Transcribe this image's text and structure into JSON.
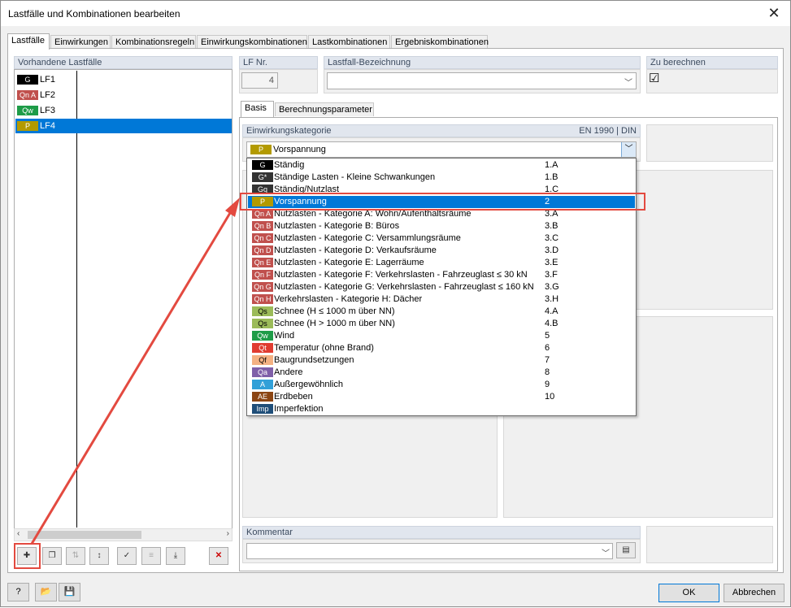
{
  "window": {
    "title": "Lastfälle und Kombinationen bearbeiten",
    "close": "✕"
  },
  "tabs": [
    {
      "label": "Lastfälle"
    },
    {
      "label": "Einwirkungen"
    },
    {
      "label": "Kombinationsregeln"
    },
    {
      "label": "Einwirkungskombinationen"
    },
    {
      "label": "Lastkombinationen"
    },
    {
      "label": "Ergebniskombinationen"
    }
  ],
  "list": {
    "header": "Vorhandene Lastfälle",
    "items": [
      {
        "badge": "G",
        "name": "LF1",
        "color": "#000000"
      },
      {
        "badge": "Qn A",
        "name": "LF2",
        "color": "#c0504d"
      },
      {
        "badge": "Qw",
        "name": "LF3",
        "color": "#1e9c48"
      },
      {
        "badge": "P",
        "name": "LF4",
        "color": "#b39a00"
      }
    ]
  },
  "toolbar_icons": [
    "new-loadcase-icon",
    "copy-loadcase-icon",
    "renumber-icon",
    "sort-icon",
    "check-icon",
    "generate-icon",
    "import-icon",
    "delete-icon"
  ],
  "lf_nr": {
    "header": "LF Nr.",
    "value": "4"
  },
  "bezeichnung": {
    "header": "Lastfall-Bezeichnung",
    "value": ""
  },
  "zu_berechnen": {
    "header": "Zu berechnen",
    "check": "☑"
  },
  "subtabs": [
    {
      "label": "Basis"
    },
    {
      "label": "Berechnungsparameter"
    }
  ],
  "kategorie": {
    "header": "Einwirkungskategorie",
    "norm": "EN 1990 | DIN",
    "selected_badge": "P",
    "selected_label": "Vorspannung",
    "selected_color": "#b39a00",
    "options": [
      {
        "badge": "G",
        "label": "Ständig",
        "code": "1.A",
        "color": "#000000"
      },
      {
        "badge": "G*",
        "label": "Ständige Lasten - Kleine Schwankungen",
        "code": "1.B",
        "color": "#333333"
      },
      {
        "badge": "Gq",
        "label": "Ständig/Nutzlast",
        "code": "1.C",
        "color": "#333333"
      },
      {
        "badge": "P",
        "label": "Vorspannung",
        "code": "2",
        "color": "#b39a00"
      },
      {
        "badge": "Qn A",
        "label": "Nutzlasten - Kategorie A: Wohn/Aufenthaltsräume",
        "code": "3.A",
        "color": "#c0504d"
      },
      {
        "badge": "Qn B",
        "label": "Nutzlasten - Kategorie B: Büros",
        "code": "3.B",
        "color": "#c0504d"
      },
      {
        "badge": "Qn C",
        "label": "Nutzlasten - Kategorie C: Versammlungsräume",
        "code": "3.C",
        "color": "#c0504d"
      },
      {
        "badge": "Qn D",
        "label": "Nutzlasten - Kategorie D: Verkaufsräume",
        "code": "3.D",
        "color": "#c0504d"
      },
      {
        "badge": "Qn E",
        "label": "Nutzlasten - Kategorie E: Lagerräume",
        "code": "3.E",
        "color": "#c0504d"
      },
      {
        "badge": "Qn F",
        "label": "Nutzlasten - Kategorie F: Verkehrslasten - Fahrzeuglast ≤ 30 kN",
        "code": "3.F",
        "color": "#c0504d"
      },
      {
        "badge": "Qn G",
        "label": "Nutzlasten - Kategorie G: Verkehrslasten - Fahrzeuglast ≤ 160 kN",
        "code": "3.G",
        "color": "#c0504d"
      },
      {
        "badge": "Qn H",
        "label": "Verkehrslasten - Kategorie H: Dächer",
        "code": "3.H",
        "color": "#c0504d"
      },
      {
        "badge": "Qs",
        "label": "Schnee (H ≤ 1000 m über NN)",
        "code": "4.A",
        "color": "#9bbb59"
      },
      {
        "badge": "Qs",
        "label": "Schnee (H > 1000 m über NN)",
        "code": "4.B",
        "color": "#9bbb59"
      },
      {
        "badge": "Qw",
        "label": "Wind",
        "code": "5",
        "color": "#1e9c48"
      },
      {
        "badge": "Qt",
        "label": "Temperatur (ohne Brand)",
        "code": "6",
        "color": "#e03c31"
      },
      {
        "badge": "Qf",
        "label": "Baugrundsetzungen",
        "code": "7",
        "color": "#f4b183"
      },
      {
        "badge": "Qa",
        "label": "Andere",
        "code": "8",
        "color": "#7f5fa8"
      },
      {
        "badge": "A",
        "label": "Außergewöhnlich",
        "code": "9",
        "color": "#31a0d8"
      },
      {
        "badge": "AE",
        "label": "Erdbeben",
        "code": "10",
        "color": "#8b4513"
      },
      {
        "badge": "Imp",
        "label": "Imperfektion",
        "code": "",
        "color": "#1f4e79"
      }
    ]
  },
  "kommentar": {
    "header": "Kommentar",
    "value": ""
  },
  "footer": {
    "ok": "OK",
    "cancel": "Abbrechen"
  }
}
